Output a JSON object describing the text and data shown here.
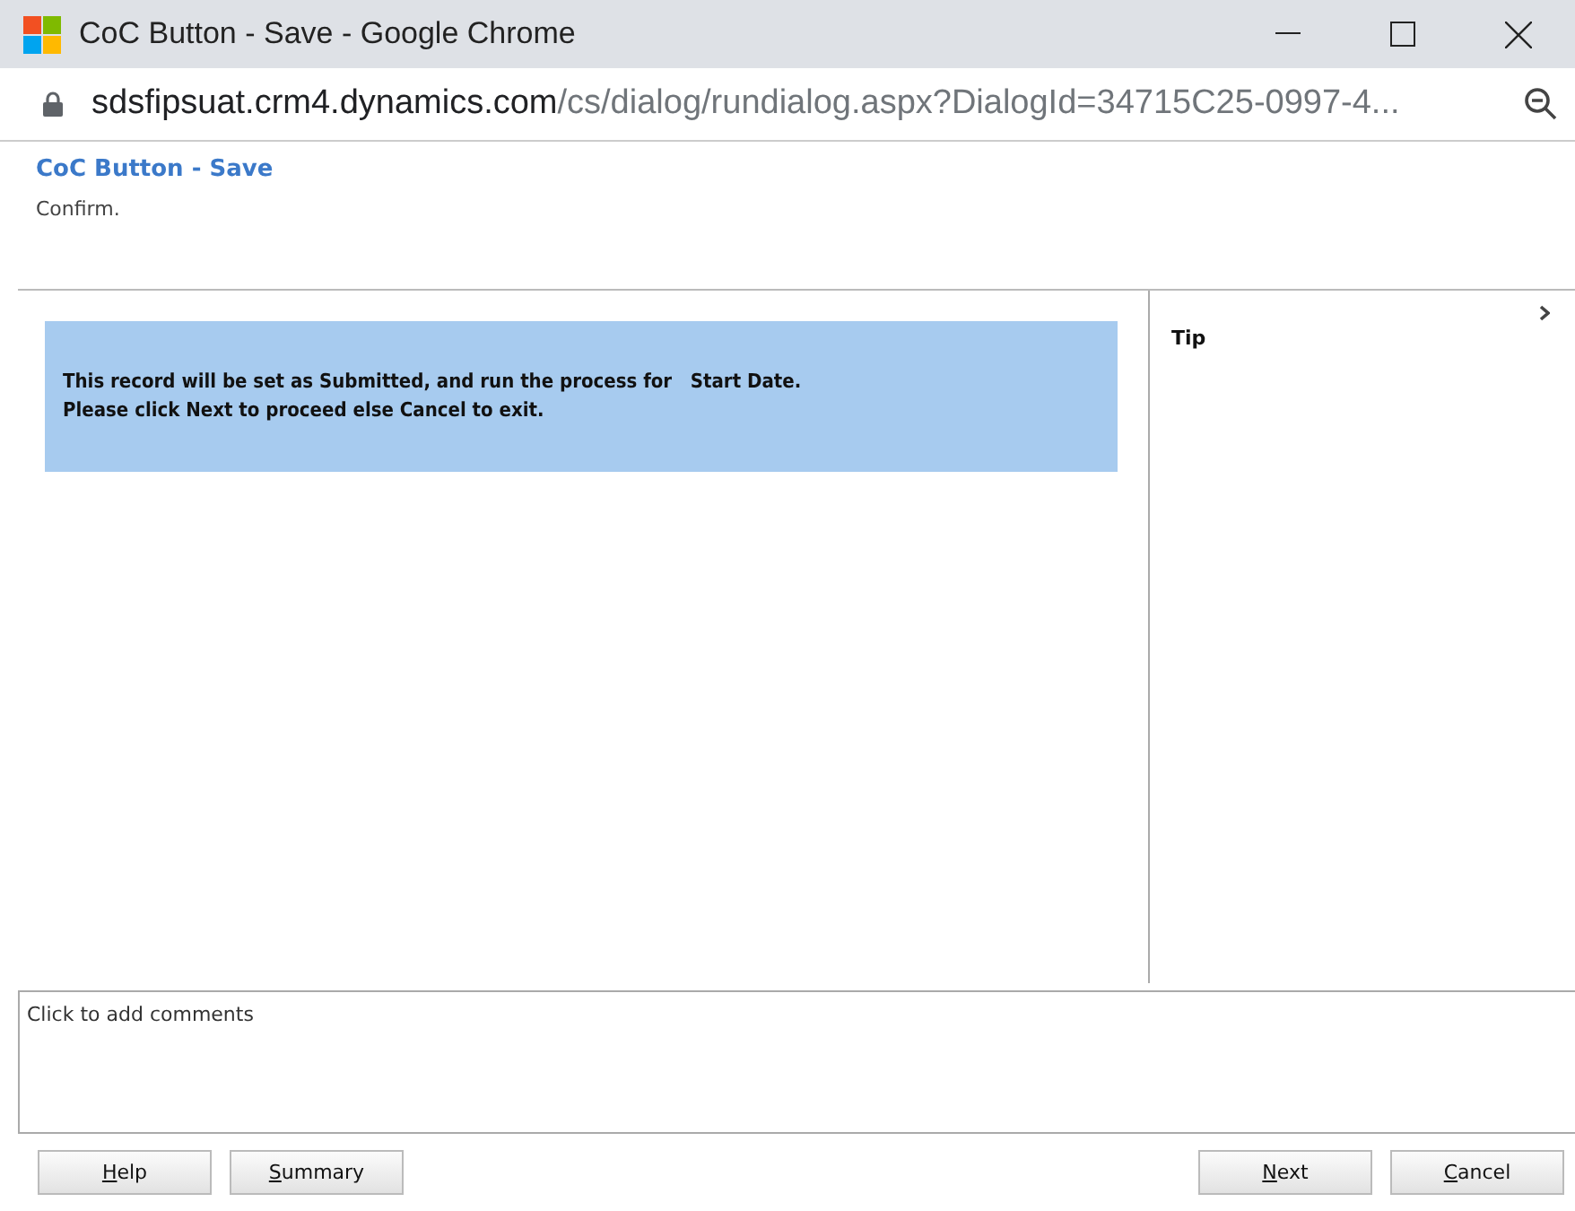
{
  "window": {
    "title": "CoC Button - Save - Google Chrome"
  },
  "address_bar": {
    "host": "sdsfipsuat.crm4.dynamics.com",
    "path": "/cs/dialog/rundialog.aspx?DialogId=34715C25-0997-4..."
  },
  "dialog": {
    "title": "CoC Button - Save",
    "subtitle": "Confirm."
  },
  "message": {
    "lines": [
      "This record will be set as Submitted, and run the process for   Start Date.",
      "Please click Next to proceed else Cancel to exit."
    ]
  },
  "tip_pane": {
    "title": "Tip",
    "expanded": false
  },
  "comments": {
    "placeholder": "Click to add comments"
  },
  "buttons_left": [
    {
      "label": "Help",
      "access_key_underlined": true
    },
    {
      "label": "Summary",
      "access_key_underlined": true
    }
  ],
  "buttons_right": [
    {
      "label": "Next",
      "access_key_underlined": true
    },
    {
      "label": "Cancel",
      "access_key_underlined": true
    }
  ]
}
